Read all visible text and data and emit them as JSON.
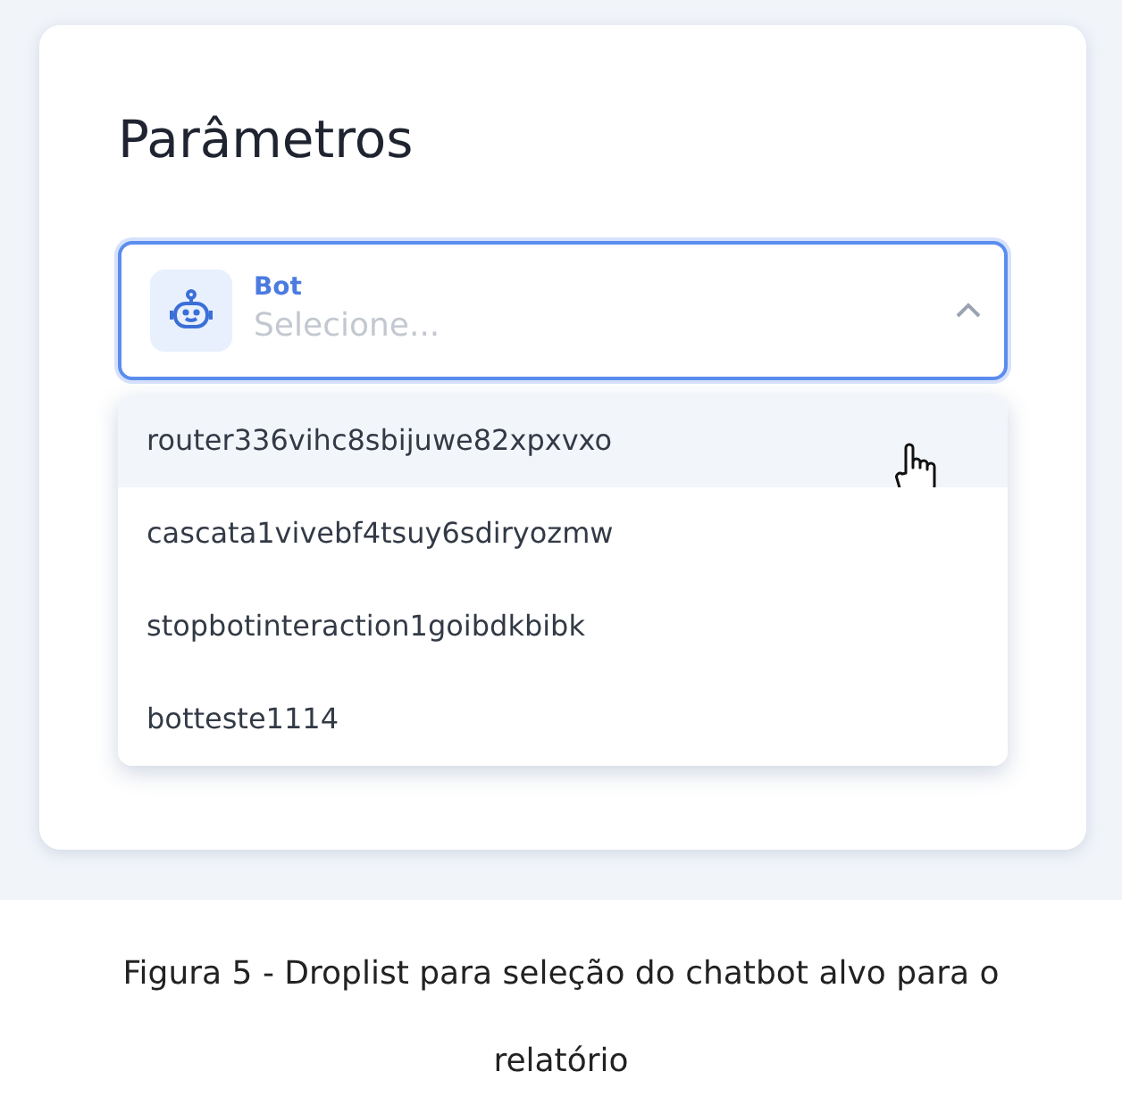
{
  "panel": {
    "title": "Parâmetros"
  },
  "bot_select": {
    "label": "Bot",
    "placeholder": "Selecione...",
    "expanded": true
  },
  "options": [
    {
      "label": "router336vihc8sbijuwe82xpxvxo",
      "hovered": true
    },
    {
      "label": "cascata1vivebf4tsuy6sdiryozmw",
      "hovered": false
    },
    {
      "label": "stopbotinteraction1goibdkbibk",
      "hovered": false
    },
    {
      "label": "botteste1114",
      "hovered": false
    }
  ],
  "caption": "Figura 5 - Droplist para seleção do chatbot alvo para o relatório"
}
